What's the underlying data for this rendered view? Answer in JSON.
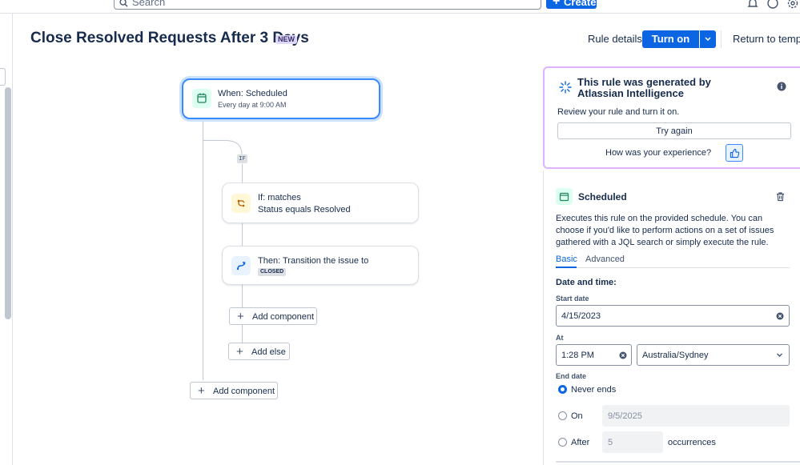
{
  "topbar": {
    "search_placeholder": "Search",
    "create_label": "Create",
    "icons": [
      "bell-icon",
      "help-icon",
      "settings-icon"
    ]
  },
  "header": {
    "title": "Close Resolved Requests After 3 Days",
    "badge": "NEW",
    "rule_details": "Rule details",
    "turn_on": "Turn on rule",
    "return_to_template": "Return to template"
  },
  "flow": {
    "trigger": {
      "title": "When: Scheduled",
      "subtitle": "Every day at 9:00 AM",
      "icon": "calendar-icon"
    },
    "if_badge": "IF",
    "condition": {
      "title": "If: matches",
      "subtitle": "Status equals Resolved",
      "icon": "branch-icon"
    },
    "action": {
      "title": "Then: Transition the issue to",
      "status": "CLOSED",
      "icon": "transition-icon"
    },
    "add_component_inner": "Add component",
    "add_else": "Add else",
    "add_component_outer": "Add component"
  },
  "ai_card": {
    "title": "This rule was generated by Atlassian Intelligence",
    "review": "Review your rule and turn it on.",
    "try_again": "Try again",
    "experience_question": "How was your experience?"
  },
  "scheduled": {
    "title": "Scheduled",
    "description": "Executes this rule on the provided schedule. You can choose if you'd like to perform actions on a set of issues gathered with a JQL search or simply execute the rule.",
    "tabs": [
      {
        "label": "Basic",
        "active": true
      },
      {
        "label": "Advanced",
        "active": false
      }
    ],
    "section_heading": "Date and time:",
    "start_date_label": "Start date",
    "start_date": "4/15/2023",
    "at_label": "At",
    "at_time": "1:28 PM",
    "timezone": "Australia/Sydney",
    "end_date_label": "End date",
    "end_options": {
      "never": "Never ends",
      "on": "On",
      "on_date": "9/5/2025",
      "after": "After",
      "after_count": "5",
      "occurrences": "occurrences"
    },
    "selected_end_option": "never"
  },
  "colors": {
    "primary": "#0c66e4",
    "badge_bg": "#dfd8fd",
    "ai_border": "#e0b3ff",
    "trigger_border": "#388bff"
  }
}
